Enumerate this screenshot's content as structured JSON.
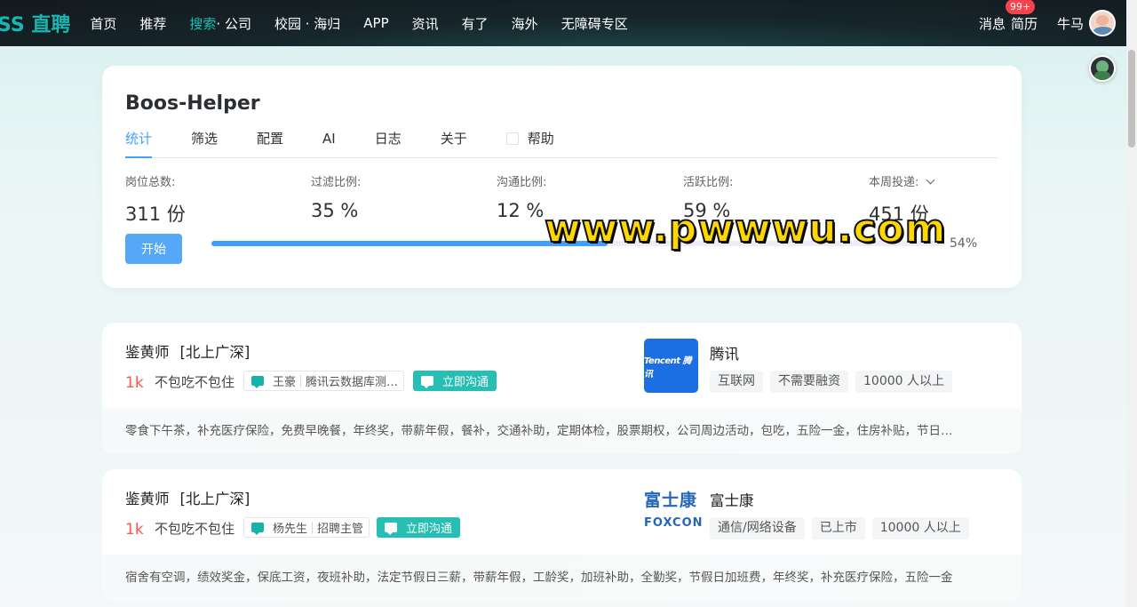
{
  "nav": {
    "logo": "SS 直聘",
    "items": [
      "首页",
      "推荐"
    ],
    "search_company": {
      "main": "搜索",
      "sub": "· 公司"
    },
    "items2": [
      "校园 · 海归",
      "APP",
      "资讯",
      "有了",
      "海外",
      "无障碍专区"
    ],
    "messages": "消息",
    "badge": "99+",
    "resume": "简历",
    "username": "牛马"
  },
  "helper": {
    "title": "Boos-Helper",
    "tabs": [
      "统计",
      "筛选",
      "配置",
      "AI",
      "日志",
      "关于",
      "帮助"
    ],
    "stats": [
      {
        "label": "岗位总数:",
        "value": "311 份"
      },
      {
        "label": "过滤比例:",
        "value": "35 %"
      },
      {
        "label": "沟通比例:",
        "value": "12 %"
      },
      {
        "label": "活跃比例:",
        "value": "59 %"
      },
      {
        "label": "本周投递:",
        "value": "451 份"
      }
    ],
    "start_button": "开始",
    "progress": 0.54,
    "progress_text": "54%"
  },
  "watermark": "www.pwwwu.com",
  "jobs": [
    {
      "title": "鉴黄师",
      "city": "[北上广深]",
      "salary": "1k",
      "tag": "不包吃不包住",
      "recruiter_name": "王豪",
      "recruiter_title": "腾讯云数据库测…",
      "chat_label": "立即沟通",
      "company_name": "腾讯",
      "company_logo_text": "Tencent 腾讯",
      "company_tags": [
        "互联网",
        "不需要融资",
        "10000 人以上"
      ],
      "benefits": "零食下午茶，补充医疗保险，免费早晚餐，年终奖，带薪年假，餐补，交通补助，定期体检，股票期权，公司周边活动，包吃，五险一金，住房补贴，节日…"
    },
    {
      "title": "鉴黄师",
      "city": "[北上广深]",
      "salary": "1k",
      "tag": "不包吃不包住",
      "recruiter_name": "杨先生",
      "recruiter_title": "招聘主管",
      "chat_label": "立即沟通",
      "company_name": "富士康",
      "company_logo_top": "富士康",
      "company_logo_bottom": "FOXCON",
      "company_tags": [
        "通信/网络设备",
        "已上市",
        "10000 人以上"
      ],
      "benefits": "宿舍有空调，绩效奖金，保底工资，夜班补助，法定节假日三薪，带薪年假，工龄奖，加班补助，全勤奖，节假日加班费，年终奖，补充医疗保险，五险一金"
    }
  ]
}
